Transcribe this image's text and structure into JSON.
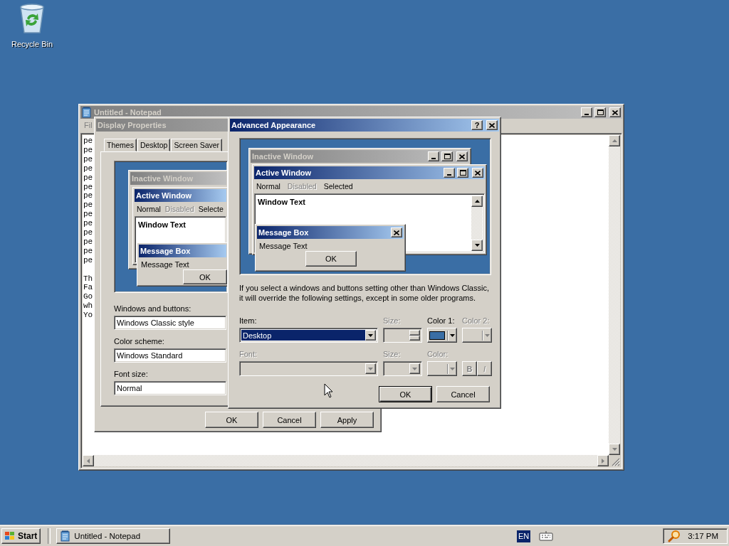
{
  "desktop": {
    "icons": [
      {
        "label": "Recycle Bin"
      }
    ]
  },
  "notepad": {
    "title": "Untitled - Notepad",
    "active": false,
    "menu": [
      "Fil"
    ],
    "paragraphs": [
      [
        "pe",
        "pe",
        "pe",
        "pe",
        "pe",
        "pe",
        "pe",
        "pe",
        "pe",
        "pe",
        "pe",
        "pe",
        "pe",
        "pe"
      ],
      [
        "Th",
        "Fa",
        "Go",
        "wh",
        "Yo"
      ]
    ]
  },
  "display_properties": {
    "title": "Display Properties",
    "active": false,
    "tabs": [
      {
        "label": "Themes",
        "selected": false
      },
      {
        "label": "Desktop",
        "selected": false
      },
      {
        "label": "Screen Saver",
        "selected": false
      }
    ],
    "preview": {
      "inactive_title": "Inactive Window",
      "active_title": "Active Window",
      "menu": [
        {
          "label": "Normal",
          "disabled": false
        },
        {
          "label": "Disabled",
          "disabled": true
        },
        {
          "label": "Selecte",
          "disabled": false
        }
      ],
      "window_text": "Window Text",
      "message_title": "Message Box",
      "message_text": "Message Text",
      "message_button": "OK"
    },
    "fields": [
      {
        "label": "Windows and buttons:",
        "value": "Windows Classic style"
      },
      {
        "label": "Color scheme:",
        "value": "Windows Standard"
      },
      {
        "label": "Font size:",
        "value": "Normal"
      }
    ],
    "buttons": [
      "OK",
      "Cancel",
      "Apply"
    ]
  },
  "advanced_appearance": {
    "title": "Advanced Appearance",
    "active": true,
    "help_button": "?",
    "preview": {
      "inactive_title": "Inactive Window",
      "active_title": "Active Window",
      "menu": [
        {
          "label": "Normal",
          "disabled": false
        },
        {
          "label": "Disabled",
          "disabled": true
        },
        {
          "label": "Selected",
          "disabled": false
        }
      ],
      "window_text": "Window Text",
      "message_title": "Message Box",
      "message_text": "Message Text",
      "message_button": "OK"
    },
    "note": "If you select a windows and buttons setting other than Windows Classic, it will override the following settings, except in some older programs.",
    "fields": [
      {
        "label": "Item:",
        "kind": "dropdown",
        "value": "Desktop",
        "disabled": false,
        "focused": true
      },
      {
        "label": "Size:",
        "kind": "spinner",
        "disabled": true
      },
      {
        "label": "Color 1:",
        "kind": "color",
        "color": "#3a6ea5",
        "disabled": false
      },
      {
        "label": "Color 2:",
        "kind": "color",
        "disabled": true
      },
      {
        "label": "Font:",
        "kind": "dropdown",
        "disabled": true,
        "focused": false
      },
      {
        "label": "Size:",
        "kind": "dropdown",
        "disabled": true,
        "focused": false
      },
      {
        "label": "Color:",
        "kind": "color",
        "disabled": true
      },
      {
        "kind": "style",
        "disabled": true,
        "buttons": [
          {
            "label": "B"
          },
          {
            "label": "I"
          }
        ]
      }
    ],
    "buttons": [
      {
        "label": "OK",
        "default": true
      },
      {
        "label": "Cancel",
        "default": false
      }
    ]
  },
  "taskbar": {
    "start": "Start",
    "tasks": [
      {
        "label": "Untitled - Notepad",
        "selected": false
      }
    ],
    "language": "EN",
    "clock": "3:17 PM"
  }
}
